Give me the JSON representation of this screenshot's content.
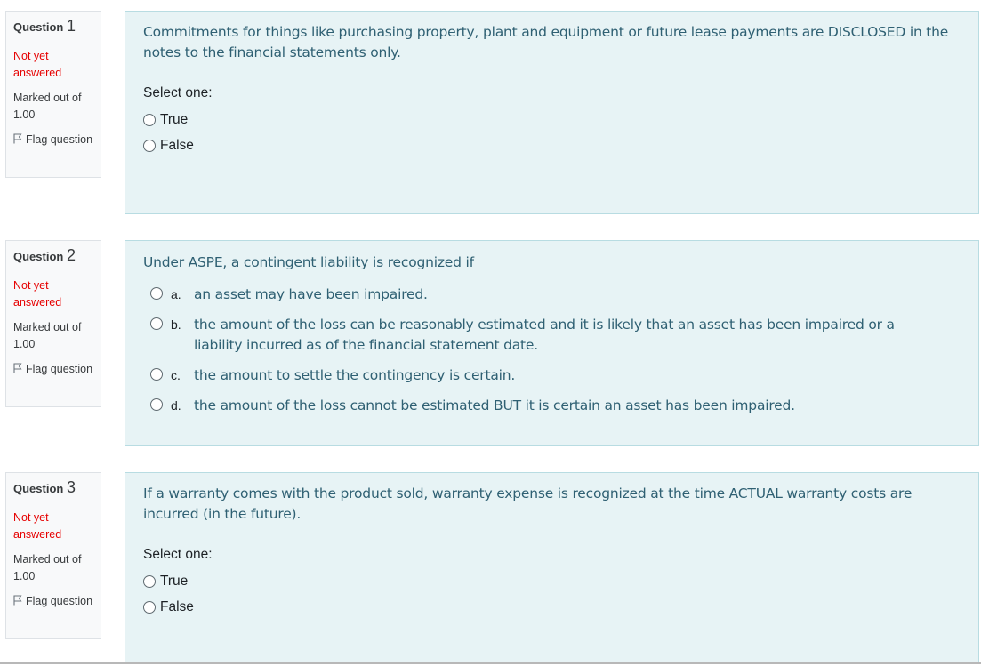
{
  "questions": [
    {
      "label": "Question",
      "number": "1",
      "state": "Not yet answered",
      "grade": "Marked out of 1.00",
      "flag_label": "Flag question",
      "text": "Commitments for things like purchasing property, plant and equipment or future lease payments are DISCLOSED in the notes to the financial statements only.",
      "prompt": "Select one:",
      "options": [
        "True",
        "False"
      ]
    },
    {
      "label": "Question",
      "number": "2",
      "state": "Not yet answered",
      "grade": "Marked out of 1.00",
      "flag_label": "Flag question",
      "text": "Under ASPE, a contingent liability is recognized if",
      "options": [
        {
          "letter": "a.",
          "text": "an asset may have been impaired."
        },
        {
          "letter": "b.",
          "text": "the amount of the loss can be reasonably estimated and it is likely that an asset has been impaired or a liability incurred as of the financial statement date."
        },
        {
          "letter": "c.",
          "text": "the amount to settle the contingency is certain."
        },
        {
          "letter": "d.",
          "text": "the amount of the loss cannot be estimated BUT it is certain an asset has been impaired."
        }
      ]
    },
    {
      "label": "Question",
      "number": "3",
      "state": "Not yet answered",
      "grade": "Marked out of 1.00",
      "flag_label": "Flag question",
      "text": "If a warranty comes with the product sold, warranty expense is recognized at the time ACTUAL warranty costs are incurred (in the future).",
      "prompt": "Select one:",
      "options": [
        "True",
        "False"
      ]
    }
  ],
  "colors": {
    "state": "#e60000",
    "content_bg": "#e7f3f5",
    "content_border": "#b8dce2",
    "question_text": "#2f6073"
  }
}
